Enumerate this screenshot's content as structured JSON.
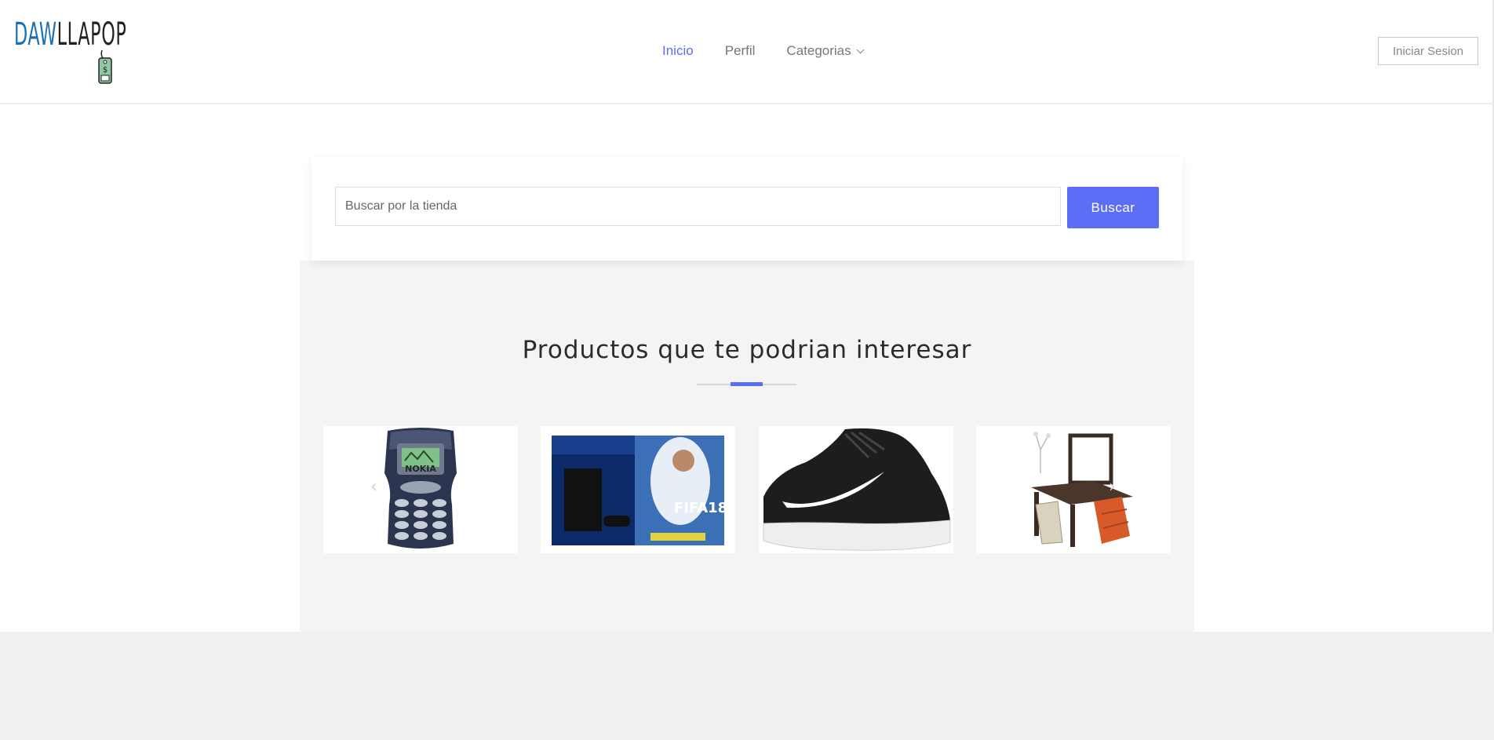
{
  "brand": {
    "logo_part1": "DAW",
    "logo_part2": "LLAPOP"
  },
  "nav": {
    "items": [
      {
        "label": "Inicio",
        "active": true
      },
      {
        "label": "Perfil",
        "active": false
      },
      {
        "label": "Categorias",
        "active": false,
        "has_dropdown": true
      }
    ]
  },
  "header": {
    "login_label": "Iniciar Sesion"
  },
  "search": {
    "placeholder": "Buscar por la tienda",
    "value": "",
    "button_label": "Buscar"
  },
  "products": {
    "title": "Productos que te podrian interesar",
    "items": [
      {
        "icon": "nokia-phone-image"
      },
      {
        "icon": "ps4-box-image"
      },
      {
        "icon": "sneaker-image"
      },
      {
        "icon": "desk-image"
      }
    ]
  },
  "colors": {
    "accent": "#5b6ef5",
    "logo_blue": "#1b6fb3",
    "section_bg": "#f4f4f4"
  }
}
